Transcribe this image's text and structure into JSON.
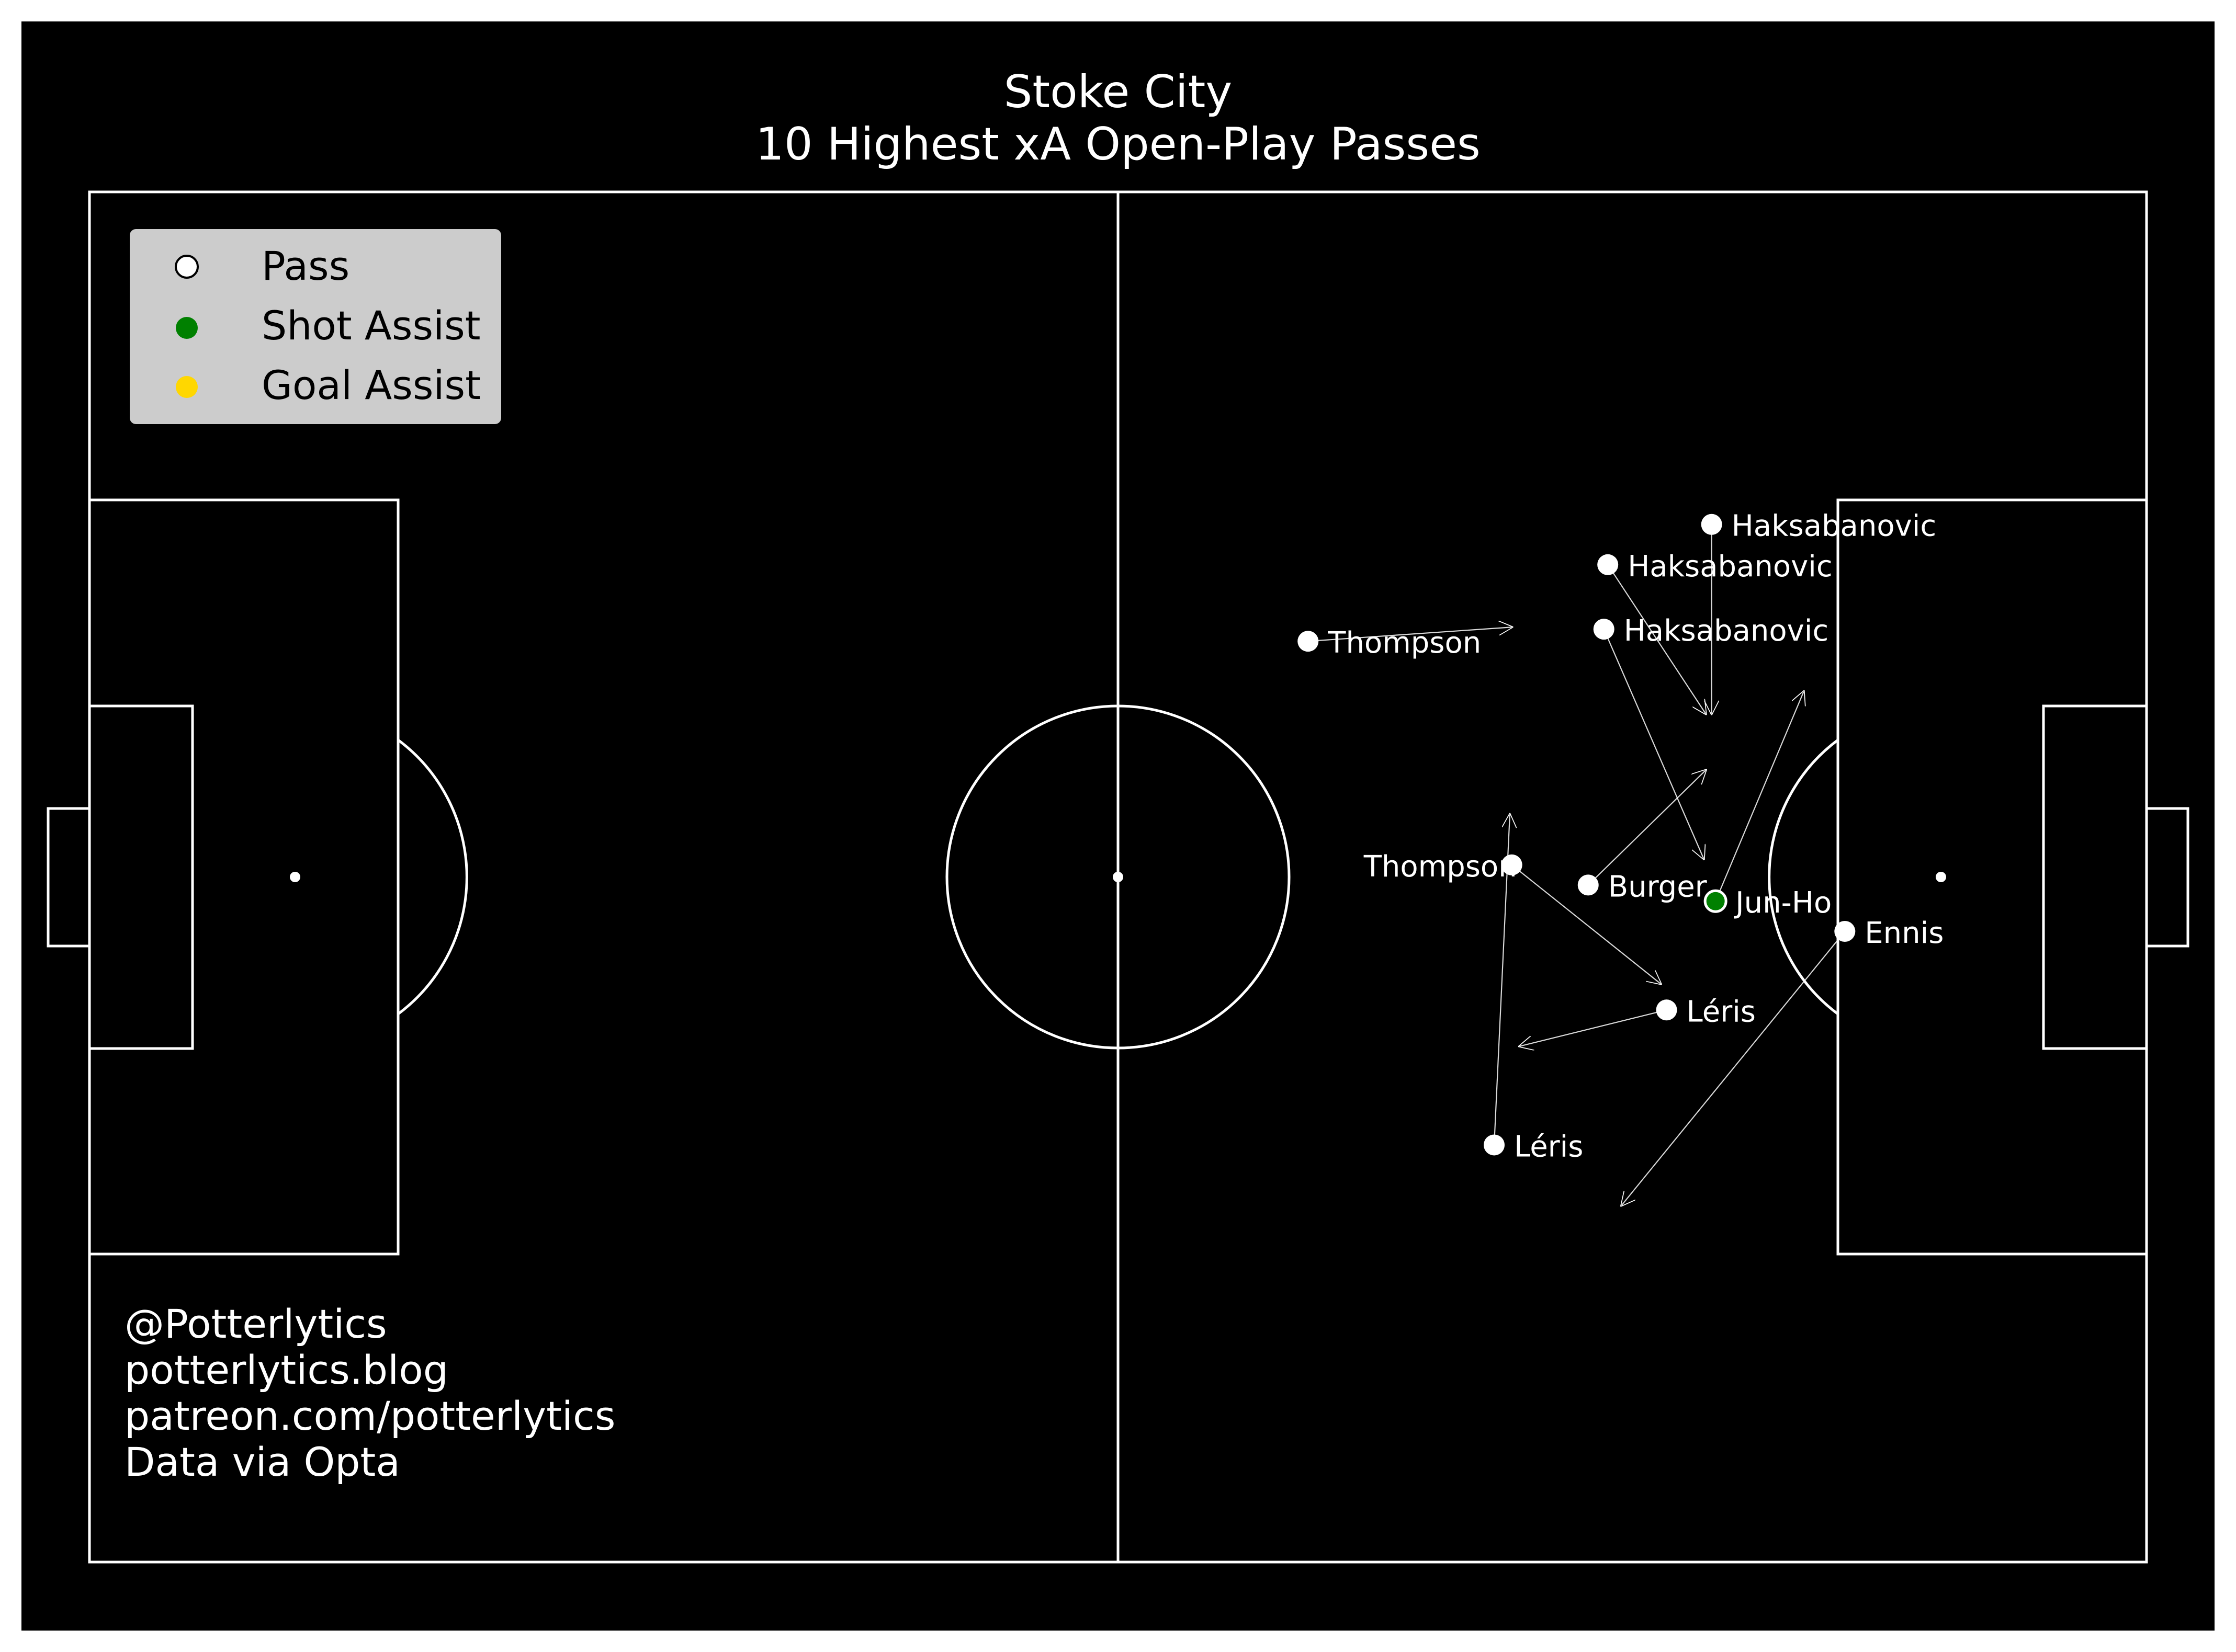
{
  "colors": {
    "background": "#000000",
    "lines": "#ffffff",
    "pass": "#ffffff",
    "shot_assist": "#008000",
    "goal_assist": "#ffd700",
    "legend_bg": "#cccccc",
    "legend_text": "#000000"
  },
  "legend": {
    "pass_label": "Pass",
    "shot_assist_label": "Shot Assist",
    "goal_assist_label": "Goal Assist"
  },
  "credits": {
    "line1": "@Potterlytics",
    "line2": "potterlytics.blog",
    "line3": "patreon.com/potterlytics",
    "line4": "Data via Opta"
  },
  "chart_data": {
    "type": "scatter",
    "title": "Stoke City",
    "subtitle": "10 Highest xA Open-Play Passes",
    "pitch": {
      "length": 105,
      "width": 68
    },
    "passes": [
      {
        "player": "Haksabanovic",
        "type": "pass",
        "x": 82.8,
        "y": 16.5,
        "end_x": 82.8,
        "end_y": 25.9
      },
      {
        "player": "Haksabanovic",
        "type": "pass",
        "x": 77.5,
        "y": 18.5,
        "end_x": 82.5,
        "end_y": 25.9
      },
      {
        "player": "Haksabanovic",
        "type": "pass",
        "x": 77.3,
        "y": 21.7,
        "end_x": 82.4,
        "end_y": 33.1
      },
      {
        "player": "Thompson",
        "type": "pass",
        "x": 62.2,
        "y": 22.3,
        "end_x": 72.6,
        "end_y": 21.6
      },
      {
        "player": "Thompson",
        "type": "pass",
        "x": 72.6,
        "y": 33.4,
        "end_x": 80.2,
        "end_y": 39.3
      },
      {
        "player": "Burger",
        "type": "pass",
        "x": 76.5,
        "y": 34.4,
        "end_x": 82.5,
        "end_y": 28.7
      },
      {
        "player": "Jun-Ho",
        "type": "shot_assist",
        "x": 83.0,
        "y": 35.2,
        "end_x": 87.5,
        "end_y": 24.8
      },
      {
        "player": "Ennis",
        "type": "pass",
        "x": 89.6,
        "y": 36.7,
        "end_x": 78.2,
        "end_y": 50.3
      },
      {
        "player": "Léris",
        "type": "pass",
        "x": 80.5,
        "y": 40.6,
        "end_x": 73.0,
        "end_y": 42.4
      },
      {
        "player": "Léris",
        "type": "pass",
        "x": 71.7,
        "y": 47.3,
        "end_x": 72.5,
        "end_y": 30.9
      }
    ]
  }
}
